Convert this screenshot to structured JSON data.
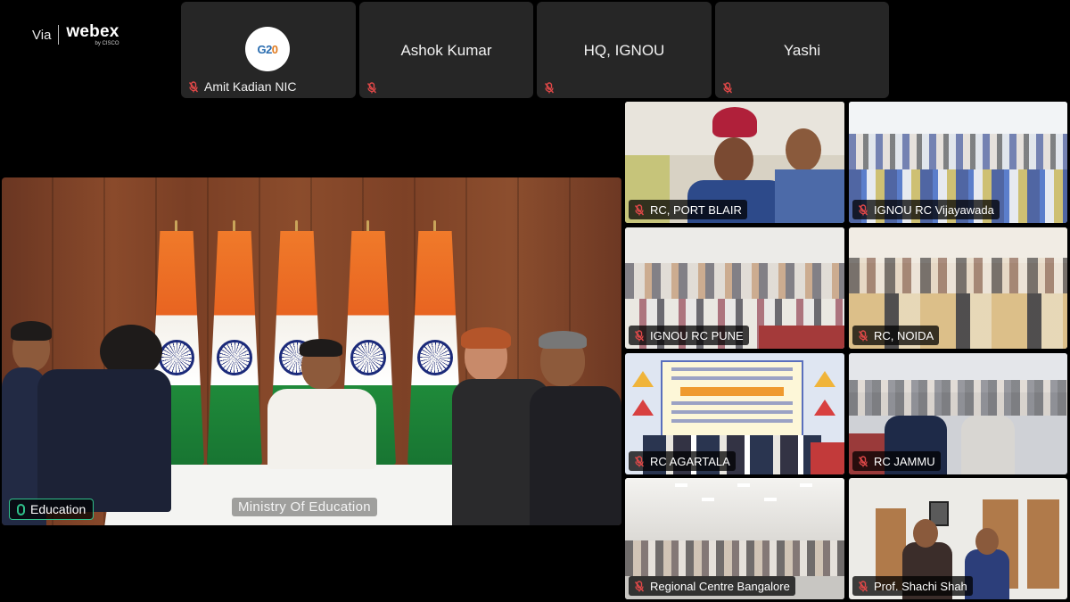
{
  "branding": {
    "via": "Via",
    "product": "webex",
    "by": "by CISCO"
  },
  "top_participants": [
    {
      "name": "Amit Kadian NIC",
      "center_text": "",
      "avatar": "G20",
      "mic": "muted"
    },
    {
      "name": "",
      "center_text": "Ashok Kumar",
      "mic": "muted"
    },
    {
      "name": "",
      "center_text": "HQ, IGNOU",
      "mic": "muted"
    },
    {
      "name": "",
      "center_text": "Yashi",
      "mic": "muted"
    }
  ],
  "main_stage": {
    "participant_label": "Education",
    "watermark": "Ministry Of Education",
    "mic": "active"
  },
  "grid": [
    {
      "label": "RC, PORT BLAIR",
      "mic": "muted"
    },
    {
      "label": "IGNOU RC Vijayawada",
      "mic": "muted"
    },
    {
      "label": "IGNOU RC PUNE",
      "mic": "muted"
    },
    {
      "label": "RC, NOIDA",
      "mic": "muted"
    },
    {
      "label": "RC AGARTALA",
      "mic": "muted"
    },
    {
      "label": "RC JAMMU",
      "mic": "muted"
    },
    {
      "label": "Regional Centre Bangalore",
      "mic": "muted"
    },
    {
      "label": "Prof. Shachi Shah",
      "mic": "muted"
    }
  ],
  "colors": {
    "muted_icon": "#e04848",
    "active_speaker": "#2fc08a",
    "tile_bg": "#262626"
  }
}
